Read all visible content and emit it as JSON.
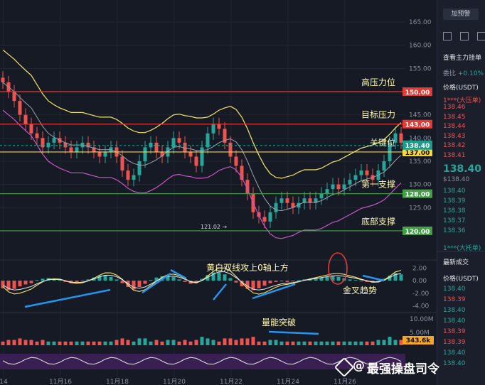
{
  "chart_data": {
    "type": "candlestick",
    "pair_unit": "USDT",
    "x_tick_labels": [
      "14",
      "11月16",
      "11月18",
      "11月20",
      "11月22",
      "11月24",
      "11月26"
    ],
    "y_ticks": [
      "165.00",
      "160.00",
      "155.00",
      "150.00",
      "145.00",
      "140.00",
      "135.00",
      "130.00",
      "125.00"
    ],
    "ylim": [
      118,
      167
    ],
    "levels": [
      {
        "label": "高压力位",
        "value": 150.0,
        "tag": "150.00",
        "color": "#e53935"
      },
      {
        "label": "目标压力",
        "value": 143.0,
        "tag": "143.00",
        "color": "#e53935"
      },
      {
        "label": "关键位",
        "value": 137.0,
        "tag": "137.00",
        "color": "#fdd835"
      },
      {
        "label": "第一支撑",
        "value": 128.0,
        "tag": "128.00",
        "color": "#43a047"
      },
      {
        "label": "底部支撑",
        "value": 120.0,
        "tag": "120.00",
        "color": "#43a047"
      }
    ],
    "last_price": 138.4,
    "last_price_tag": "138.40",
    "low_marker": "121.02",
    "close_series": [
      152,
      150,
      148,
      145,
      143,
      141,
      140,
      138,
      139,
      140,
      139,
      138,
      137,
      138,
      139,
      138,
      137,
      136,
      137,
      138,
      136,
      133,
      131,
      132,
      135,
      138,
      139,
      137,
      136,
      138,
      140,
      139,
      137,
      136,
      134,
      138,
      141,
      143,
      142,
      139,
      136,
      134,
      131,
      128,
      124,
      123,
      122,
      124,
      126,
      127,
      126,
      125,
      126,
      127,
      126,
      127,
      128,
      129,
      130,
      129,
      130,
      131,
      132,
      133,
      132,
      131,
      133,
      135,
      139,
      141,
      139
    ],
    "macd": {
      "y_ticks": [
        "2.00",
        "0.00",
        "-2.00",
        "-4.00"
      ],
      "ylim": [
        -4.6,
        2.6
      ],
      "hist": [
        -1.2,
        -1.5,
        -1.3,
        -0.9,
        -0.6,
        -0.4,
        0.1,
        0.3,
        0.4,
        0.2,
        0.1,
        -0.2,
        -0.4,
        -0.3,
        -0.1,
        0.2,
        0.5,
        0.8,
        0.9,
        0.6,
        0.2,
        -0.4,
        -1.0,
        -1.4,
        -1.0,
        -0.5,
        0.1,
        0.5,
        0.7,
        0.8,
        0.6,
        0.2,
        -0.2,
        -0.5,
        -0.3,
        0.3,
        0.9,
        1.3,
        1.4,
        1.0,
        0.4,
        -0.3,
        -0.9,
        -1.3,
        -1.5,
        -1.2,
        -0.8,
        -0.4,
        -0.2,
        -0.1,
        -0.2,
        -0.1,
        0.1,
        0.2,
        0.3,
        0.4,
        0.5,
        0.6,
        0.7,
        0.6,
        0.4,
        0.2,
        0.1,
        -0.1,
        -0.2,
        -0.3,
        -0.1,
        0.3,
        0.8,
        1.2,
        1.0
      ],
      "annotation": "黄白双线攻上0轴上方",
      "cross_label": "金叉趋势"
    },
    "volume": {
      "y_ticks": [
        "10.00M",
        "5.00M"
      ],
      "last_tag": "343.6k",
      "annotation": "量能突破"
    }
  },
  "sidebar": {
    "button_label": "加预警",
    "main_order_label": "查看主力挂单",
    "ratio_label": "委比",
    "ratio_value": "+0.10%",
    "price_header": "价格(USDT)",
    "ask_big_label": "1***(大压单)",
    "asks": [
      "138.46",
      "138.45",
      "138.44",
      "138.43",
      "138.42",
      "138.41"
    ],
    "mid_price": "138.40",
    "mid_sub": "$138.40",
    "bids": [
      "138.40",
      "138.39",
      "138.38",
      "138.37",
      "138.36"
    ],
    "bid_big_label": "1***(大托单)",
    "trades_header": "最新成交",
    "trades_price_header": "价格(USDT)",
    "trades": [
      "138.40",
      "138.39",
      "138.40",
      "138.40",
      "138.39",
      "138.39",
      "138.40",
      "138.40"
    ]
  },
  "watermark": {
    "text": "最强操盘司令",
    "at": "@"
  }
}
